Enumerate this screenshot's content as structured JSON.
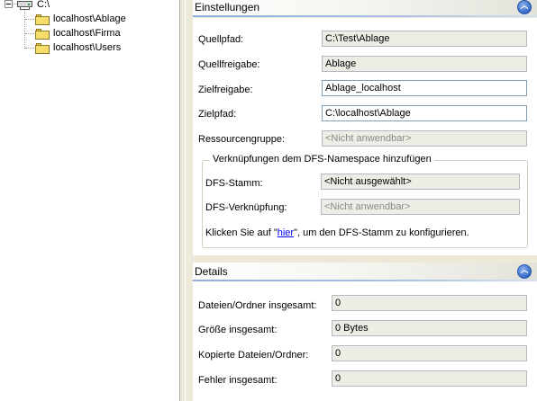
{
  "tree": {
    "root": {
      "label": "C:\\",
      "icon": "network-drive-icon"
    },
    "children": [
      {
        "label": "localhost\\Ablage",
        "icon": "folder-icon"
      },
      {
        "label": "localhost\\Firma",
        "icon": "folder-icon"
      },
      {
        "label": "localhost\\Users",
        "icon": "folder-icon"
      }
    ]
  },
  "settings": {
    "title": "Einstellungen",
    "collapse_icon": "chevron-up-icon",
    "fields": {
      "quellpfad": {
        "label": "Quellpfad:",
        "value": "C:\\Test\\Ablage"
      },
      "quellfreigabe": {
        "label": "Quellfreigabe:",
        "value": "Ablage"
      },
      "zielfreigabe": {
        "label": "Zielfreigabe:",
        "value": "Ablage_localhost"
      },
      "zielpfad": {
        "label": "Zielpfad:",
        "value": "C:\\localhost\\Ablage"
      },
      "ressourcengruppe": {
        "label": "Ressourcengruppe:",
        "value": "<Nicht anwendbar>"
      }
    },
    "dfs": {
      "group_title": "Verknüpfungen dem DFS-Namespace hinzufügen",
      "stamm": {
        "label": "DFS-Stamm:",
        "value": "<Nicht ausgewählt>"
      },
      "verknuepfung": {
        "label": "DFS-Verknüpfung:",
        "value": "<Nicht anwendbar>"
      },
      "hint_before": "Klicken Sie auf \"",
      "hint_link": "hier",
      "hint_after": "\", um den DFS-Stamm zu konfigurieren."
    }
  },
  "details": {
    "title": "Details",
    "collapse_icon": "chevron-up-icon",
    "fields": {
      "dateien": {
        "label": "Dateien/Ordner insgesamt:",
        "value": "0"
      },
      "groesse": {
        "label": "Größe insgesamt:",
        "value": "0 Bytes"
      },
      "kopiert": {
        "label": "Kopierte Dateien/Ordner:",
        "value": "0"
      },
      "fehler": {
        "label": "Fehler insgesamt:",
        "value": "0"
      }
    }
  }
}
